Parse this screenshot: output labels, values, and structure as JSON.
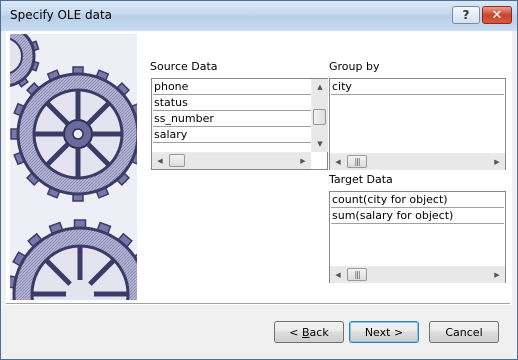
{
  "window": {
    "title": "Specify OLE data",
    "help_glyph": "?",
    "close_glyph": "✕"
  },
  "source": {
    "label": "Source Data",
    "items": [
      "phone",
      "status",
      "ss_number",
      "salary"
    ]
  },
  "group": {
    "label": "Group by",
    "items": [
      "city"
    ]
  },
  "target": {
    "label": "Target Data",
    "items": [
      "count(city for object)",
      "sum(salary for object)"
    ]
  },
  "scroll_glyphs": {
    "up": "▲",
    "down": "▼",
    "left": "◀",
    "right": "▶",
    "grip": "|||"
  },
  "buttons": {
    "back_prefix": "< ",
    "back_u": "B",
    "back_rest": "ack",
    "next": "Next >",
    "cancel": "Cancel"
  },
  "colors": {
    "title_bg": "#c4d8ee",
    "close_red": "#c8452e",
    "gear": "#5a5a8c",
    "focus_border": "#3c7fb1"
  }
}
